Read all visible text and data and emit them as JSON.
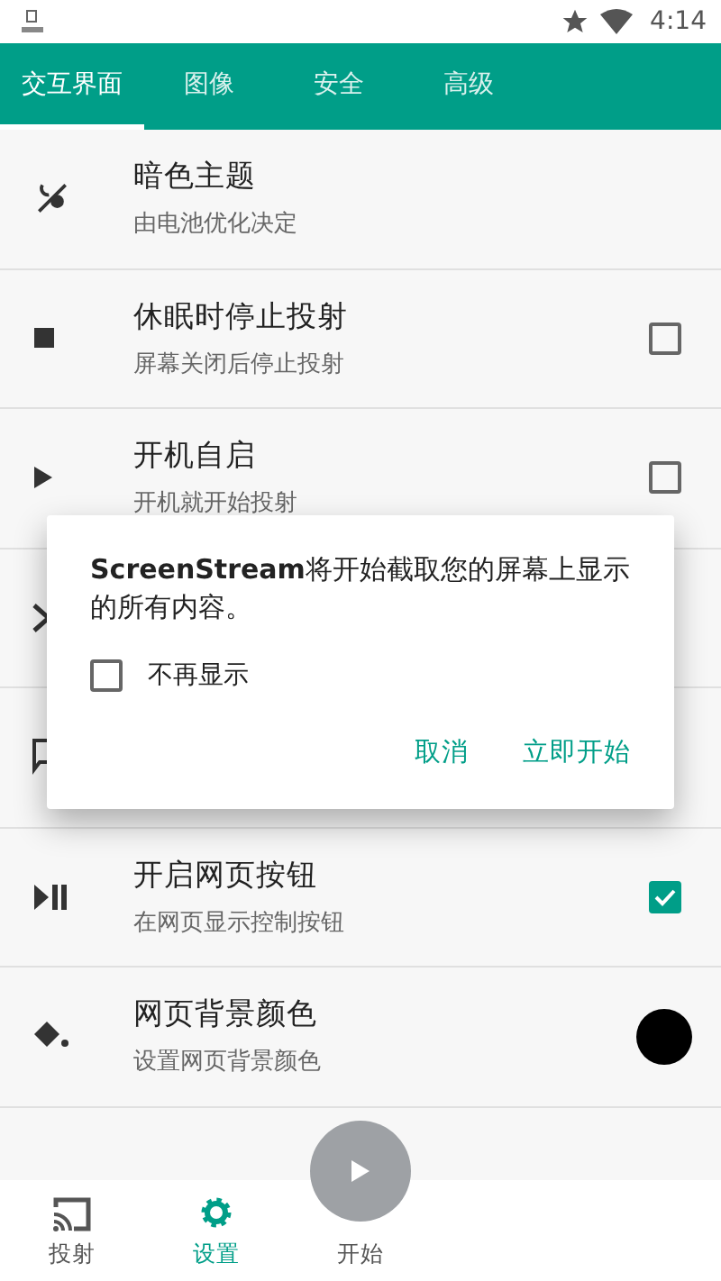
{
  "status_bar": {
    "time": "4:14"
  },
  "tabs": [
    {
      "label": "交互界面",
      "selected": true
    },
    {
      "label": "图像",
      "selected": false
    },
    {
      "label": "安全",
      "selected": false
    },
    {
      "label": "高级",
      "selected": false
    }
  ],
  "settings": [
    {
      "title": "暗色主题",
      "subtitle": "由电池优化决定",
      "kind": "plain"
    },
    {
      "title": "休眠时停止投射",
      "subtitle": "屏幕关闭后停止投射",
      "kind": "checkbox",
      "checked": false
    },
    {
      "title": "开机自启",
      "subtitle": "开机就开始投射",
      "kind": "checkbox",
      "checked": false
    },
    {
      "kind": "plain"
    },
    {
      "kind": "plain"
    },
    {
      "title": "开启网页按钮",
      "subtitle": "在网页显示控制按钮",
      "kind": "checkbox",
      "checked": true
    },
    {
      "title": "网页背景颜色",
      "subtitle": "设置网页背景颜色",
      "kind": "color",
      "color": "#000000"
    }
  ],
  "dialog": {
    "message": "**ScreenStream**将开始截取您的屏幕上显示的所有内容。",
    "checkbox": {
      "label": "不再显示",
      "checked": false
    },
    "buttons": [
      "取消",
      "立即开始"
    ]
  },
  "bottom_nav": [
    {
      "label": "投射",
      "selected": false
    },
    {
      "label": "设置",
      "selected": true
    },
    {
      "label": "开始",
      "selected": false
    }
  ]
}
